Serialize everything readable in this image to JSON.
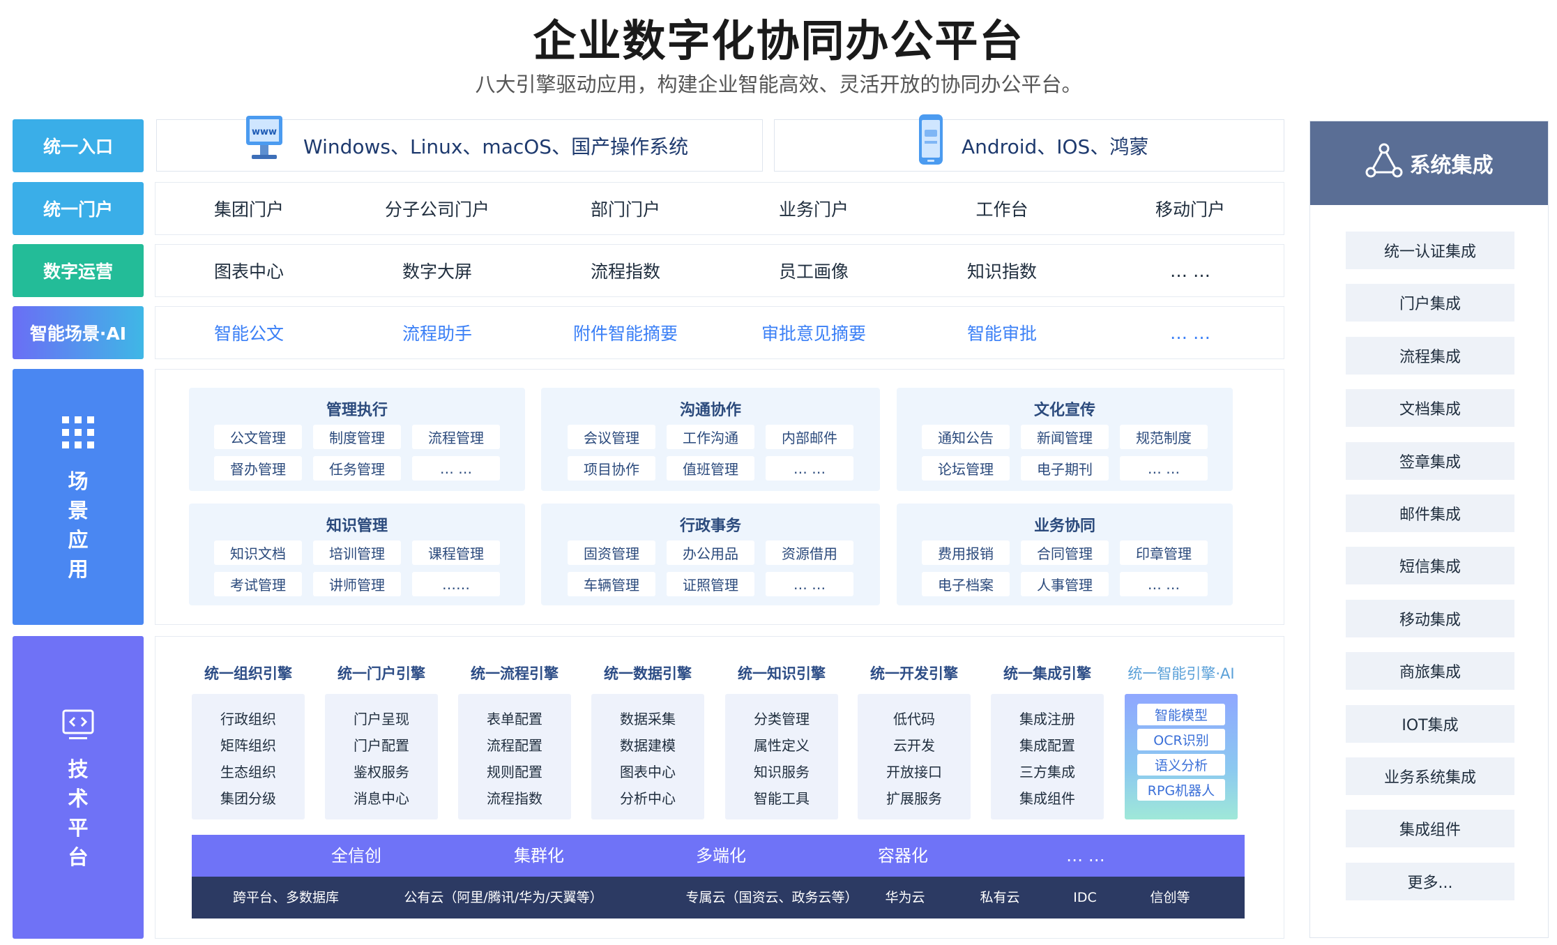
{
  "title": "企业数字化协同办公平台",
  "subtitle": "八大引擎驱动应用，构建企业智能高效、灵活开放的协同办公平台。",
  "rows": {
    "entry": {
      "label": "统一入口",
      "desktop": "Windows、Linux、macOS、国产操作系统",
      "desktop_icon": "www-monitor-icon",
      "mobile": "Android、IOS、鸿蒙",
      "mobile_icon": "mobile-phone-icon"
    },
    "portal": {
      "label": "统一门户",
      "items": [
        "集团门户",
        "分子公司门户",
        "部门门户",
        "业务门户",
        "工作台",
        "移动门户"
      ]
    },
    "digital": {
      "label": "数字运营",
      "items": [
        "图表中心",
        "数字大屏",
        "流程指数",
        "员工画像",
        "知识指数",
        "… …"
      ]
    },
    "ai": {
      "label": "智能场景·AI",
      "items": [
        "智能公文",
        "流程助手",
        "附件智能摘要",
        "审批意见摘要",
        "智能审批",
        "… …"
      ]
    }
  },
  "scene": {
    "label_chars": [
      "场",
      "景",
      "应",
      "用"
    ],
    "icon": "grid-dots-icon",
    "groups": [
      {
        "title": "管理执行",
        "items": [
          "公文管理",
          "制度管理",
          "流程管理",
          "督办管理",
          "任务管理",
          "… …"
        ]
      },
      {
        "title": "沟通协作",
        "items": [
          "会议管理",
          "工作沟通",
          "内部邮件",
          "项目协作",
          "值班管理",
          "… …"
        ]
      },
      {
        "title": "文化宣传",
        "items": [
          "通知公告",
          "新闻管理",
          "规范制度",
          "论坛管理",
          "电子期刊",
          "… …"
        ]
      },
      {
        "title": "知识管理",
        "items": [
          "知识文档",
          "培训管理",
          "课程管理",
          "考试管理",
          "讲师管理",
          "……"
        ]
      },
      {
        "title": "行政事务",
        "items": [
          "固资管理",
          "办公用品",
          "资源借用",
          "车辆管理",
          "证照管理",
          "… …"
        ]
      },
      {
        "title": "业务协同",
        "items": [
          "费用报销",
          "合同管理",
          "印章管理",
          "电子档案",
          "人事管理",
          "… …"
        ]
      }
    ]
  },
  "tech": {
    "label_chars": [
      "技",
      "术",
      "平",
      "台"
    ],
    "icon": "code-monitor-icon",
    "engines": [
      {
        "title": "统一组织引擎",
        "items": [
          "行政组织",
          "矩阵组织",
          "生态组织",
          "集团分级"
        ]
      },
      {
        "title": "统一门户引擎",
        "items": [
          "门户呈现",
          "门户配置",
          "鉴权服务",
          "消息中心"
        ]
      },
      {
        "title": "统一流程引擎",
        "items": [
          "表单配置",
          "流程配置",
          "规则配置",
          "流程指数"
        ]
      },
      {
        "title": "统一数据引擎",
        "items": [
          "数据采集",
          "数据建模",
          "图表中心",
          "分析中心"
        ]
      },
      {
        "title": "统一知识引擎",
        "items": [
          "分类管理",
          "属性定义",
          "知识服务",
          "智能工具"
        ]
      },
      {
        "title": "统一开发引擎",
        "items": [
          "低代码",
          "云开发",
          "开放接口",
          "扩展服务"
        ]
      },
      {
        "title": "统一集成引擎",
        "items": [
          "集成注册",
          "集成配置",
          "三方集成",
          "集成组件"
        ]
      },
      {
        "title": "统一智能引擎·AI",
        "items": [
          "智能模型",
          "OCR识别",
          "语义分析",
          "RPG机器人"
        ]
      }
    ],
    "bar1": [
      "全信创",
      "集群化",
      "多端化",
      "容器化",
      "… …"
    ],
    "bar2": [
      "跨平台、多数据库",
      "公有云（阿里/腾讯/华为/天翼等）",
      "专属云（国资云、政务云等）",
      "华为云",
      "私有云",
      "IDC",
      "信创等"
    ]
  },
  "integration": {
    "title": "系统集成",
    "icon": "network-triangle-icon",
    "items": [
      "统一认证集成",
      "门户集成",
      "流程集成",
      "文档集成",
      "签章集成",
      "邮件集成",
      "短信集成",
      "移动集成",
      "商旅集成",
      "IOT集成",
      "业务系统集成",
      "集成组件",
      "更多..."
    ]
  },
  "colors": {
    "entry_label": "#3aaee8",
    "portal_label": "#3aaee8",
    "digital_label": "#23bc98",
    "ai_label_start": "#6a6ef5",
    "ai_label_end": "#3fb7e6",
    "scene_label": "#4a87f2",
    "tech_label": "#6f72f6",
    "integration_head": "#5a6e95"
  }
}
